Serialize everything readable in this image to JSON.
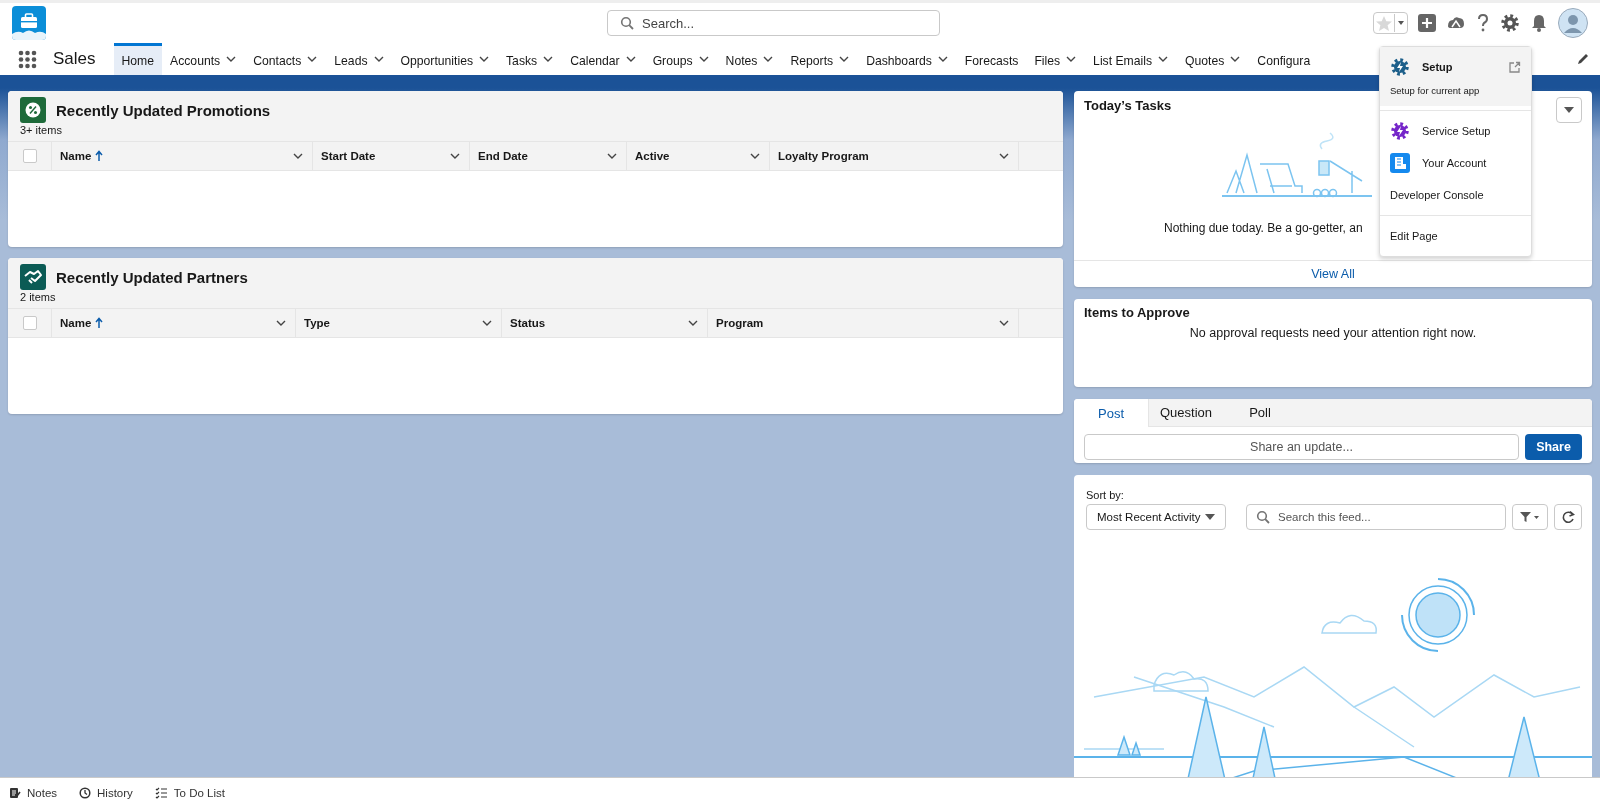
{
  "app": {
    "name": "Sales"
  },
  "search": {
    "placeholder": "Search..."
  },
  "nav": {
    "tabs": [
      {
        "label": "Home",
        "selected": true,
        "dropdown": false
      },
      {
        "label": "Accounts",
        "selected": false,
        "dropdown": true
      },
      {
        "label": "Contacts",
        "selected": false,
        "dropdown": true
      },
      {
        "label": "Leads",
        "selected": false,
        "dropdown": true
      },
      {
        "label": "Opportunities",
        "selected": false,
        "dropdown": true
      },
      {
        "label": "Tasks",
        "selected": false,
        "dropdown": true
      },
      {
        "label": "Calendar",
        "selected": false,
        "dropdown": true
      },
      {
        "label": "Groups",
        "selected": false,
        "dropdown": true
      },
      {
        "label": "Notes",
        "selected": false,
        "dropdown": true
      },
      {
        "label": "Reports",
        "selected": false,
        "dropdown": true
      },
      {
        "label": "Dashboards",
        "selected": false,
        "dropdown": true
      },
      {
        "label": "Forecasts",
        "selected": false,
        "dropdown": false
      },
      {
        "label": "Files",
        "selected": false,
        "dropdown": true
      },
      {
        "label": "List Emails",
        "selected": false,
        "dropdown": true
      },
      {
        "label": "Quotes",
        "selected": false,
        "dropdown": true
      },
      {
        "label": "Configura",
        "selected": false,
        "dropdown": false
      }
    ]
  },
  "promotions": {
    "title": "Recently Updated Promotions",
    "count": "3+ items",
    "select_all_checked": false,
    "columns": [
      {
        "label": "Name",
        "sorted": true
      },
      {
        "label": "Start Date",
        "sorted": false
      },
      {
        "label": "End Date",
        "sorted": false
      },
      {
        "label": "Active",
        "sorted": false
      },
      {
        "label": "Loyalty Program",
        "sorted": false
      }
    ]
  },
  "partners": {
    "title": "Recently Updated Partners",
    "count": "2 items",
    "select_all_checked": false,
    "columns": [
      {
        "label": "Name",
        "sorted": true
      },
      {
        "label": "Type",
        "sorted": false
      },
      {
        "label": "Status",
        "sorted": false
      },
      {
        "label": "Program",
        "sorted": false
      }
    ]
  },
  "tasks": {
    "title": "Today’s Tasks",
    "message": "Nothing due today. Be a go-getter, an",
    "link": "View All"
  },
  "approvals": {
    "title": "Items to Approve",
    "message": "No approval requests need your attention right now."
  },
  "publisher": {
    "tabs": [
      {
        "label": "Post",
        "selected": true
      },
      {
        "label": "Question",
        "selected": false
      },
      {
        "label": "Poll",
        "selected": false
      }
    ],
    "placeholder": "Share an update...",
    "button": "Share"
  },
  "feed": {
    "sort_label": "Sort by:",
    "sort_value": "Most Recent Activity",
    "search_placeholder": "Search this feed..."
  },
  "setup_menu": {
    "sections": [
      [
        {
          "kind": "setup",
          "label": "Setup",
          "description": "Setup for current app",
          "selected": true
        }
      ],
      [
        {
          "kind": "service",
          "label": "Service Setup",
          "selected": false
        },
        {
          "kind": "account",
          "label": "Your Account",
          "selected": false
        },
        {
          "kind": "plain",
          "label": "Developer Console",
          "selected": false
        }
      ],
      [
        {
          "kind": "plain",
          "label": "Edit Page",
          "selected": false
        }
      ]
    ]
  },
  "utility_bar": {
    "items": [
      {
        "kind": "notes",
        "label": "Notes"
      },
      {
        "kind": "history",
        "label": "History"
      },
      {
        "kind": "todo",
        "label": "To Do List"
      }
    ]
  }
}
